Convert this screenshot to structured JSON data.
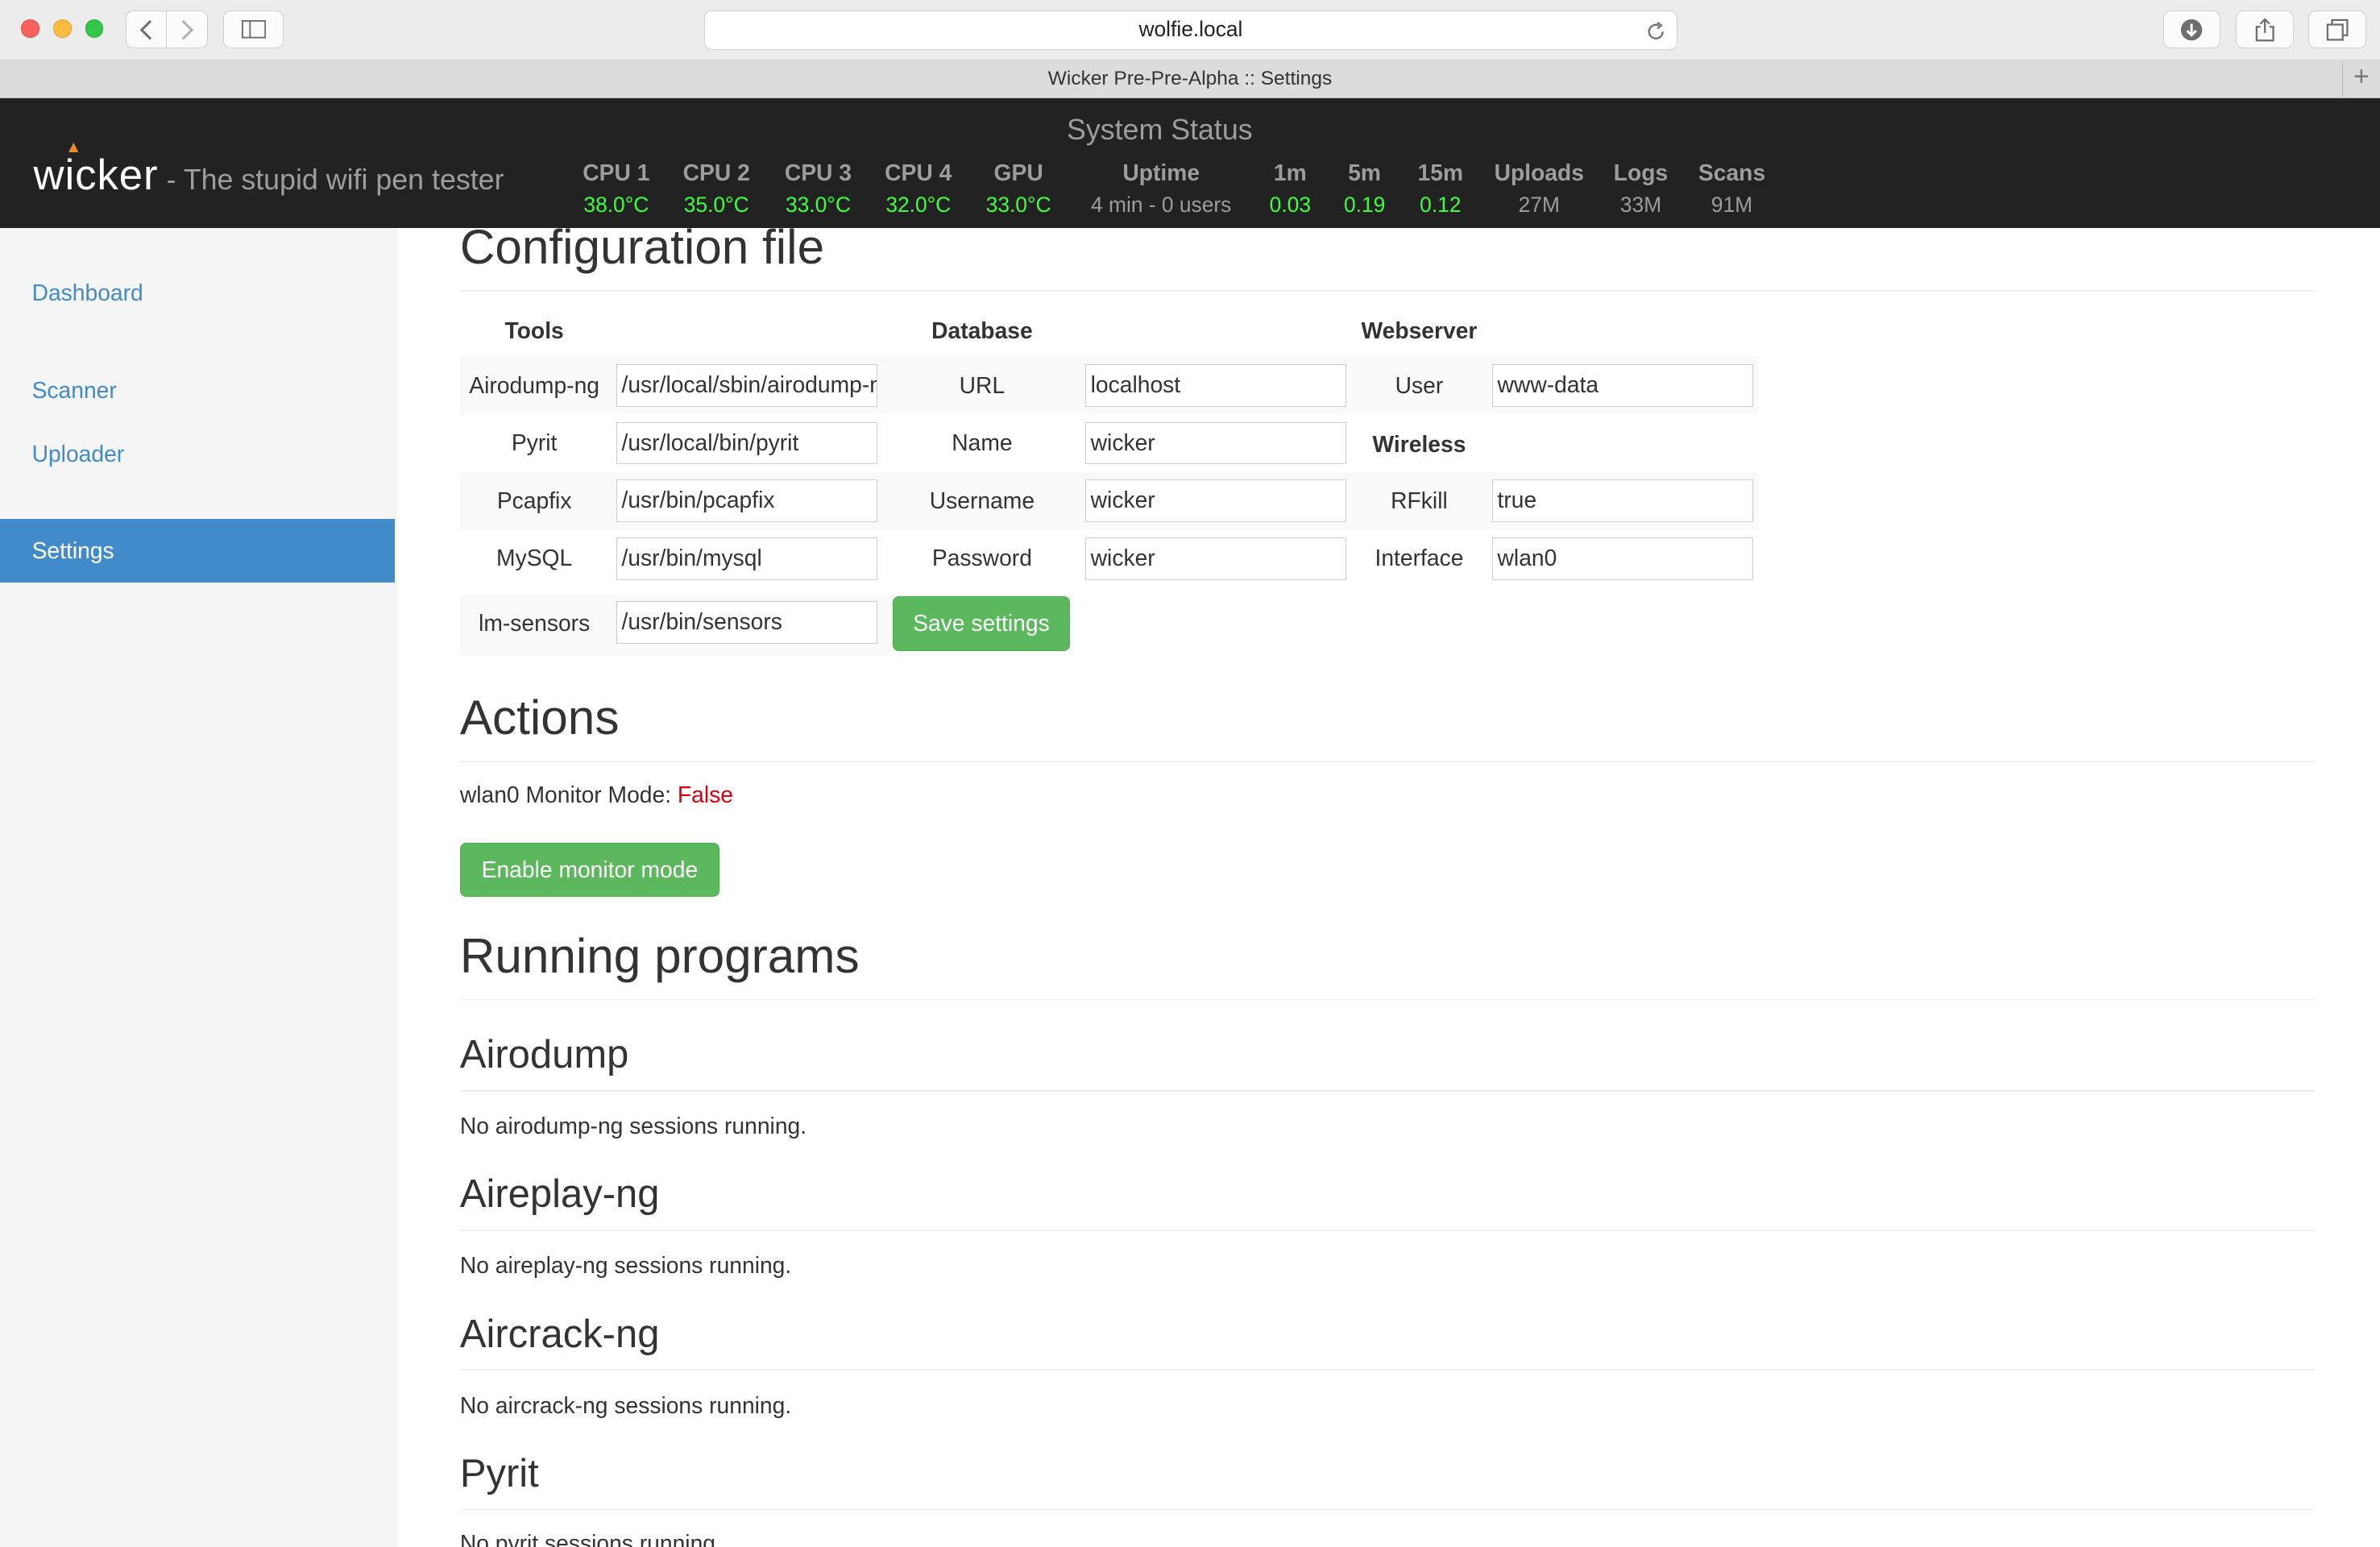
{
  "browser": {
    "url": "wolfie.local",
    "tab_title": "Wicker Pre-Pre-Alpha :: Settings"
  },
  "header": {
    "logo": "wicker",
    "tagline": "- The stupid wifi pen tester",
    "status_title": "System Status",
    "stats": [
      {
        "label": "CPU 1",
        "value": "38.0°C"
      },
      {
        "label": "CPU 2",
        "value": "35.0°C"
      },
      {
        "label": "CPU 3",
        "value": "33.0°C"
      },
      {
        "label": "CPU 4",
        "value": "32.0°C"
      },
      {
        "label": "GPU",
        "value": "33.0°C"
      },
      {
        "label": "Uptime",
        "value": "4 min - 0 users"
      },
      {
        "label": "1m",
        "value": "0.03"
      },
      {
        "label": "5m",
        "value": "0.19"
      },
      {
        "label": "15m",
        "value": "0.12"
      },
      {
        "label": "Uploads",
        "value": "27M"
      },
      {
        "label": "Logs",
        "value": "33M"
      },
      {
        "label": "Scans",
        "value": "91M"
      }
    ],
    "colors": {
      "temp_ok": "#3dff3d",
      "muted": "#9d9d9d",
      "bar_bg": "#222222"
    }
  },
  "sidebar": {
    "items": [
      {
        "label": "Dashboard"
      },
      {
        "label": "Scanner"
      },
      {
        "label": "Uploader"
      },
      {
        "label": "Settings",
        "active": true
      }
    ]
  },
  "config": {
    "title": "Configuration file",
    "tools_header": "Tools",
    "database_header": "Database",
    "webserver_header": "Webserver",
    "wireless_header": "Wireless",
    "tools": [
      {
        "label": "Airodump-ng",
        "value": "/usr/local/sbin/airodump-ng"
      },
      {
        "label": "Pyrit",
        "value": "/usr/local/bin/pyrit"
      },
      {
        "label": "Pcapfix",
        "value": "/usr/bin/pcapfix"
      },
      {
        "label": "MySQL",
        "value": "/usr/bin/mysql"
      },
      {
        "label": "lm-sensors",
        "value": "/usr/bin/sensors"
      }
    ],
    "database": [
      {
        "label": "URL",
        "value": "localhost"
      },
      {
        "label": "Name",
        "value": "wicker"
      },
      {
        "label": "Username",
        "value": "wicker"
      },
      {
        "label": "Password",
        "value": "wicker"
      }
    ],
    "webserver": [
      {
        "label": "User",
        "value": "www-data"
      }
    ],
    "wireless": [
      {
        "label": "RFkill",
        "value": "true"
      },
      {
        "label": "Interface",
        "value": "wlan0"
      }
    ],
    "save_label": "Save settings"
  },
  "actions": {
    "title": "Actions",
    "monitor_label": "wlan0 Monitor Mode:",
    "monitor_value": "False",
    "enable_button": "Enable monitor mode"
  },
  "running": {
    "title": "Running programs",
    "programs": [
      {
        "name": "Airodump",
        "status": "No airodump-ng sessions running."
      },
      {
        "name": "Aireplay-ng",
        "status": "No aireplay-ng sessions running."
      },
      {
        "name": "Aircrack-ng",
        "status": "No aircrack-ng sessions running."
      },
      {
        "name": "Pyrit",
        "status": "No pyrit sessions running."
      }
    ]
  }
}
